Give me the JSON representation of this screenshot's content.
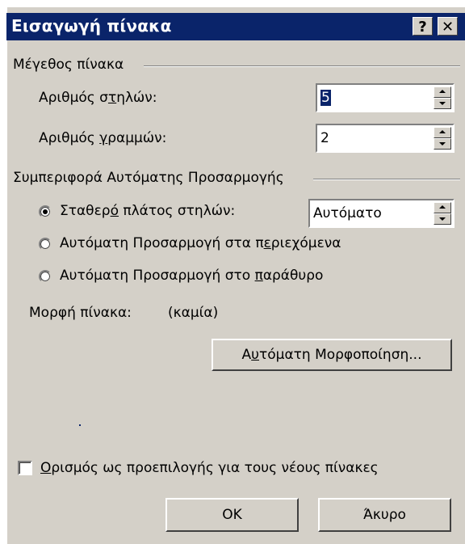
{
  "dialog": {
    "title": "Εισαγωγή πίνακα",
    "help_button": "?",
    "close_button": "✕"
  },
  "size_group": {
    "label": "Μέγεθος πίνακα",
    "columns_label_pre": "Αριθμός σ",
    "columns_label_u": "τ",
    "columns_label_post": "ηλών:",
    "columns_value": "5",
    "rows_label_pre": "Αριθμός ",
    "rows_label_u": "γ",
    "rows_label_post": "ραμμών:",
    "rows_value": "2"
  },
  "autofit_group": {
    "label": "Συμπεριφορά Αυτόματης Προσαρμογής",
    "fixed_pre": "Σταθερ",
    "fixed_u": "ό",
    "fixed_post": " πλάτος στηλών:",
    "fixed_value": "Αυτόματο",
    "contents_pre": "Αυτόματη Προσαρμογή στα π",
    "contents_u": "ε",
    "contents_post": "ριεχόμενα",
    "window_pre": "Αυτόματη Προσαρμογή στο ",
    "window_u": "π",
    "window_post": "αράθυρο",
    "selected_option": "fixed"
  },
  "format": {
    "label": "Μορφή πίνακα:",
    "value": "(καμία)",
    "autoformat_pre": "Α",
    "autoformat_u": "υ",
    "autoformat_post": "τόματη Μορφοποίηση..."
  },
  "default_checkbox": {
    "label_u": "Ο",
    "label_post": "ρισμός ως προεπιλογής για τους νέους πίνακες",
    "checked": false
  },
  "buttons": {
    "ok": "ΟΚ",
    "cancel": "Άκυρο"
  },
  "colors": {
    "titlebar": "#0a246a",
    "face": "#d4d0c8"
  }
}
